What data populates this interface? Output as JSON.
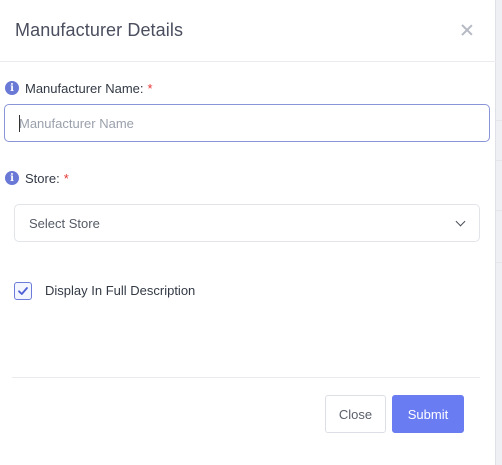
{
  "modal": {
    "title": "Manufacturer Details"
  },
  "fields": {
    "manufacturer_name": {
      "label": "Manufacturer Name:",
      "required_mark": "*",
      "value": "",
      "placeholder": "Manufacturer Name"
    },
    "store": {
      "label": "Store:",
      "required_mark": "*",
      "selected": "Select Store"
    },
    "display_in_full_description": {
      "label": "Display In Full Description",
      "checked": true
    }
  },
  "footer": {
    "close_label": "Close",
    "submit_label": "Submit"
  },
  "colors": {
    "accent": "#6a7cf2",
    "info_icon": "#6a78d6",
    "required": "#e53935"
  },
  "icons": {
    "close": "close-icon",
    "info": "info-icon",
    "dropdown": "chevron-down-icon",
    "check": "check-icon"
  }
}
